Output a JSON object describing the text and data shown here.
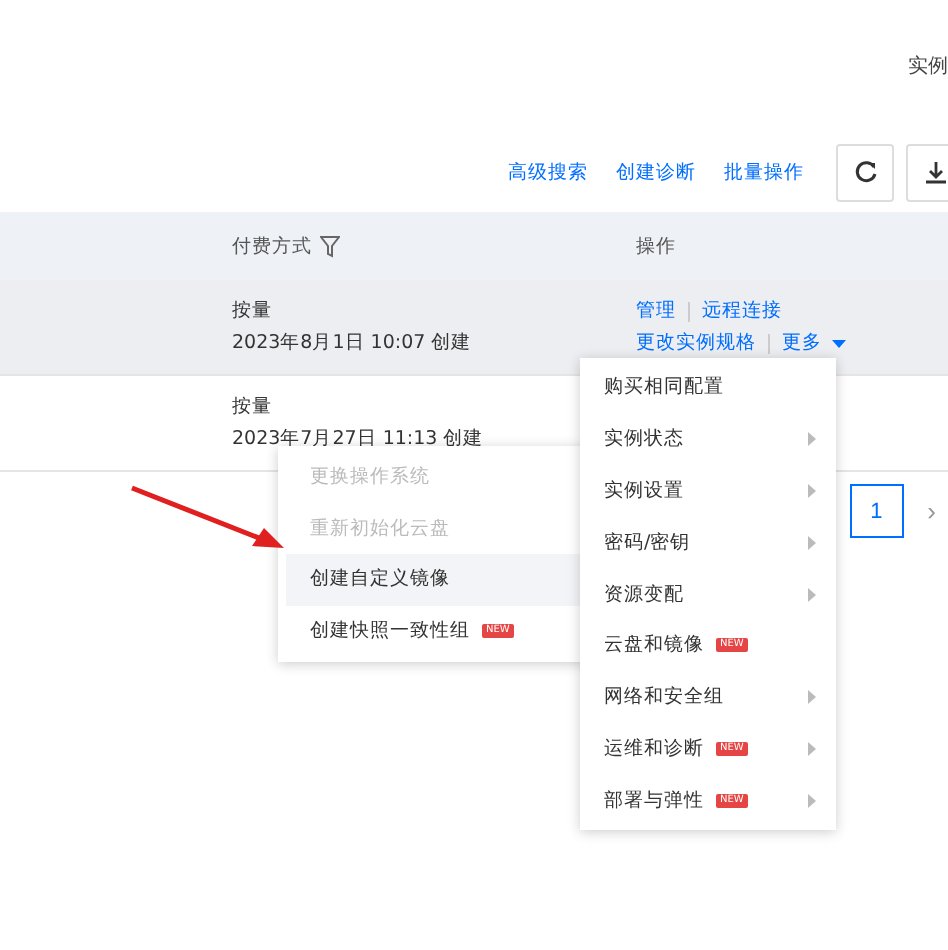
{
  "header": {
    "title": "实例"
  },
  "toolbar": {
    "links": [
      "高级搜索",
      "创建诊断",
      "批量操作"
    ]
  },
  "table": {
    "columns": [
      "付费方式",
      "操作"
    ],
    "rows": [
      {
        "billing": "按量",
        "created": "2023年8月1日 10:07 创建",
        "hovered": true,
        "actions": [
          "管理",
          "远程连接",
          "更改实例规格",
          "更多"
        ]
      },
      {
        "billing": "按量",
        "created": "2023年7月27日 11:13 创建",
        "hovered": false
      }
    ]
  },
  "pagination": {
    "pages": [
      {
        "label": "1",
        "selected": true
      }
    ],
    "next": "›"
  },
  "menu": {
    "items": [
      {
        "label": "购买相同配置",
        "submenu": false
      },
      {
        "label": "实例状态",
        "submenu": true
      },
      {
        "label": "实例设置",
        "submenu": true
      },
      {
        "label": "密码/密钥",
        "submenu": true
      },
      {
        "label": "资源变配",
        "submenu": true
      },
      {
        "label": "云盘和镜像",
        "submenu": false,
        "badge": "NEW"
      },
      {
        "label": "网络和安全组",
        "submenu": true
      },
      {
        "label": "运维和诊断",
        "submenu": true,
        "badge": "NEW"
      },
      {
        "label": "部署与弹性",
        "submenu": true,
        "badge": "NEW"
      }
    ]
  },
  "submenu": {
    "items": [
      {
        "label": "更换操作系统",
        "disabled": true,
        "selected": false
      },
      {
        "label": "重新初始化云盘",
        "disabled": true,
        "selected": false
      },
      {
        "label": "创建自定义镜像",
        "disabled": false,
        "selected": true
      },
      {
        "label": "创建快照一致性组",
        "disabled": false,
        "selected": false,
        "badge": "NEW"
      }
    ]
  }
}
